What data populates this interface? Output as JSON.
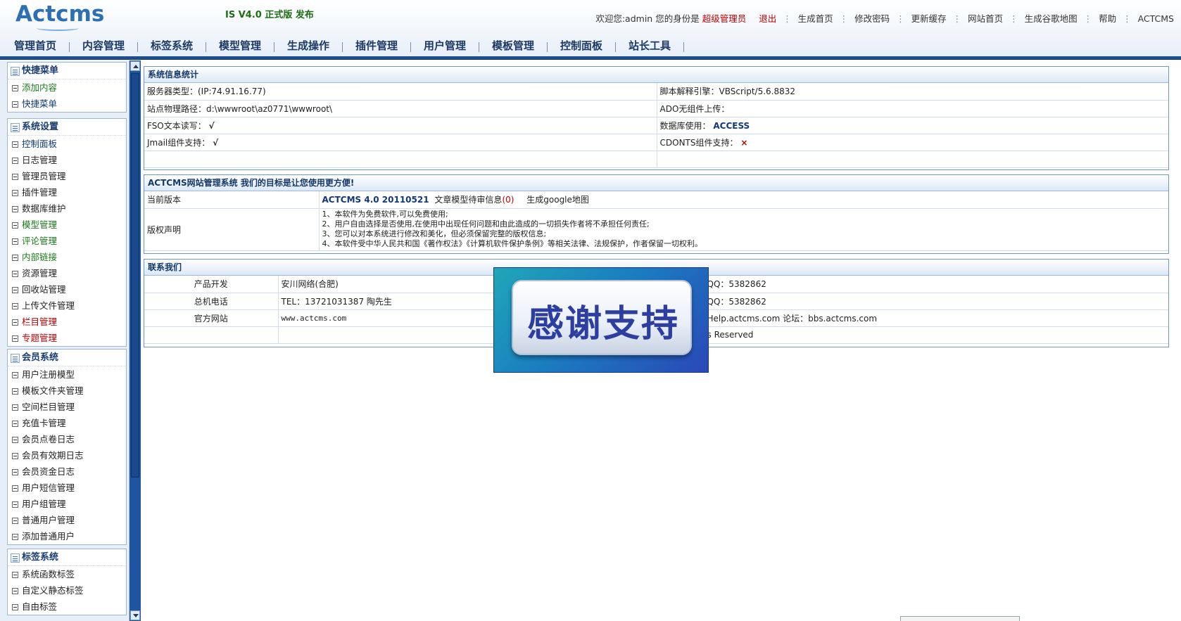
{
  "header": {
    "logo_text": "Actcms",
    "release_text": "IS V4.0 正式版 发布",
    "welcome": "欢迎您:admin 您的身份是",
    "role": "超级管理员",
    "logout": "退出",
    "links": [
      "生成首页",
      "修改密码",
      "更新缓存",
      "网站首页",
      "生成谷歌地图",
      "帮助",
      "ACTCMS"
    ]
  },
  "nav": [
    "管理首页",
    "内容管理",
    "标签系统",
    "模型管理",
    "生成操作",
    "插件管理",
    "用户管理",
    "模板管理",
    "控制面板",
    "站长工具"
  ],
  "sidebar": {
    "groups": [
      {
        "title": "快捷菜单",
        "items": [
          {
            "label": "添加内容",
            "color": "green"
          },
          {
            "label": "快捷菜单",
            "color": "blue"
          }
        ]
      },
      {
        "title": "系统设置",
        "items": [
          {
            "label": "控制面板",
            "color": "blue"
          },
          {
            "label": "日志管理",
            "color": "normal"
          },
          {
            "label": "管理员管理",
            "color": "normal"
          },
          {
            "label": "插件管理",
            "color": "normal"
          },
          {
            "label": "数据库维护",
            "color": "normal"
          },
          {
            "label": "模型管理",
            "color": "green"
          },
          {
            "label": "评论管理",
            "color": "green"
          },
          {
            "label": "内部链接",
            "color": "green"
          },
          {
            "label": "资源管理",
            "color": "normal"
          },
          {
            "label": "回收站管理",
            "color": "normal"
          },
          {
            "label": "上传文件管理",
            "color": "normal"
          },
          {
            "label": "栏目管理",
            "color": "red"
          },
          {
            "label": "专题管理",
            "color": "red"
          }
        ]
      },
      {
        "title": "会员系统",
        "items": [
          {
            "label": "用户注册模型",
            "color": "normal"
          },
          {
            "label": "模板文件夹管理",
            "color": "normal"
          },
          {
            "label": "空间栏目管理",
            "color": "normal"
          },
          {
            "label": "充值卡管理",
            "color": "normal"
          },
          {
            "label": "会员点卷日志",
            "color": "normal"
          },
          {
            "label": "会员有效期日志",
            "color": "normal"
          },
          {
            "label": "会员资金日志",
            "color": "normal"
          },
          {
            "label": "用户短信管理",
            "color": "normal"
          },
          {
            "label": "用户组管理",
            "color": "normal"
          },
          {
            "label": "普通用户管理",
            "color": "normal"
          },
          {
            "label": "添加普通用户",
            "color": "normal"
          }
        ]
      },
      {
        "title": "标签系统",
        "items": [
          {
            "label": "系统函数标签",
            "color": "normal"
          },
          {
            "label": "自定义静态标签",
            "color": "normal"
          },
          {
            "label": "自由标签",
            "color": "normal"
          }
        ]
      }
    ]
  },
  "sysinfo": {
    "title": "系统信息统计",
    "server_type": "服务器类型：(IP:74.91.16.77)",
    "script_engine": "脚本解释引擎：VBScript/5.6.8832",
    "physical_path": "站点物理路径：d:\\wwwroot\\az0771\\wwwroot\\",
    "ado_upload": "ADO无组件上传：",
    "fso_label": "FSO文本读写：",
    "fso_value": "√",
    "db_label": "数据库使用：",
    "db_value": "ACCESS",
    "jmail_label": "Jmail组件支持：",
    "jmail_value": "√",
    "cdonts_label": "CDONTS组件支持：",
    "cdonts_value": "×"
  },
  "about": {
    "title": "ACTCMS网站管理系统 我们的目标是让您使用更方便!",
    "version_label": "当前版本",
    "version_value": "ACTCMS 4.0 20110521",
    "pending_label": "文章模型待审信息",
    "pending_count": "(0)",
    "google_map": "生成google地图",
    "copyright_label": "版权声明",
    "copyright_lines": [
      "1、本软件为免费软件,可以免费使用;",
      "2、用户自由选择是否使用,在使用中出现任何问题和由此造成的一切损失作者将不承担任何责任;",
      "3、您可以对本系统进行修改和美化，但必须保留完整的版权信息;",
      "4、本软件受中华人民共和国《著作权法》《计算机软件保护条例》等相关法律、法规保护，作者保留一切权利。"
    ]
  },
  "contact": {
    "title": "联系我们",
    "rows": [
      {
        "label": "产品开发",
        "value": "安川网络(合肥)",
        "right": "QQ：5382862"
      },
      {
        "label": "总机电话",
        "value": "TEL：13721031387 陶先生",
        "right": "QQ：5382862"
      },
      {
        "label": "官方网站",
        "value": "www.actcms.com",
        "right": "Help.actcms.com 论坛：bbs.actcms.com"
      }
    ],
    "footer_right": "s Reserved"
  },
  "overlay": {
    "text": "感谢支持"
  }
}
